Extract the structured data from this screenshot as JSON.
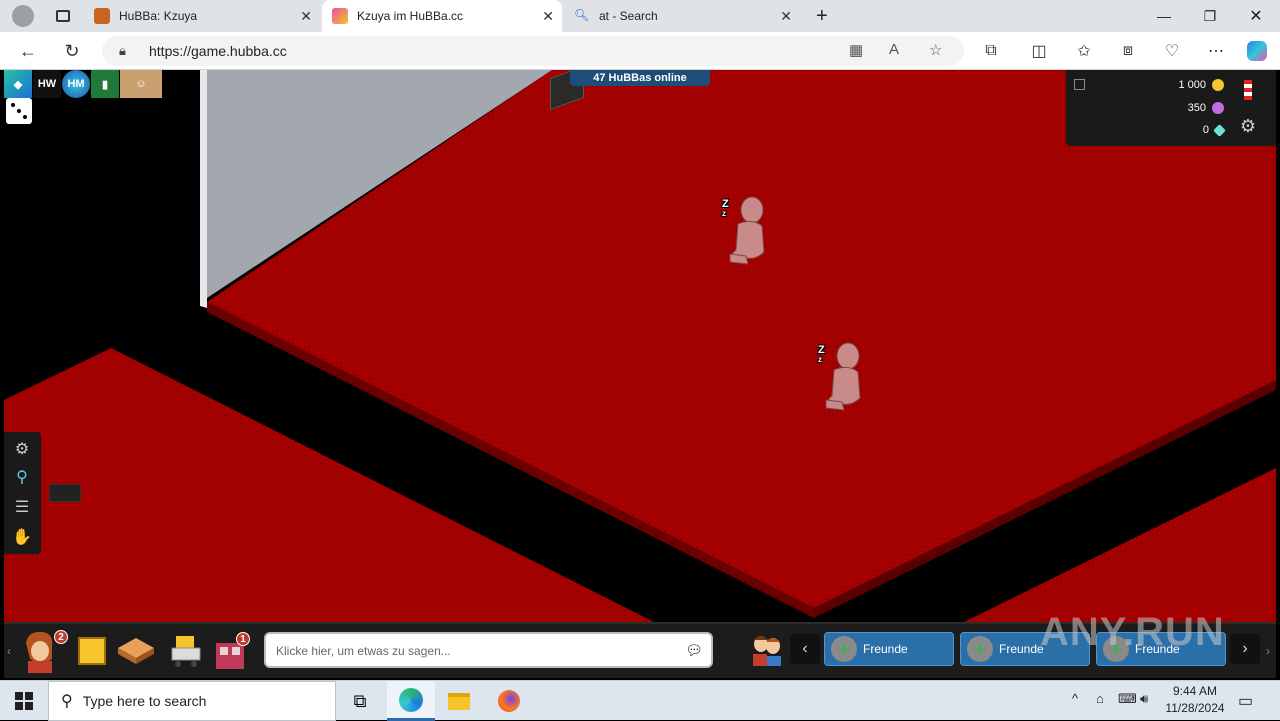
{
  "browser": {
    "tabs": [
      {
        "label": "HuBBa: Kzuya",
        "active": false
      },
      {
        "label": "Kzuya im HuBBa.cc",
        "active": true
      },
      {
        "label": "at - Search",
        "active": false
      }
    ],
    "url": "https://game.hubba.cc"
  },
  "game": {
    "online_label": "47 HuBBas online",
    "top_logos": [
      "HW",
      "HM"
    ],
    "purse": {
      "credits": "1 000",
      "duckets": "350",
      "diamonds": "0"
    },
    "avatars": [
      {
        "status": "sleeping",
        "zz": "z"
      },
      {
        "status": "sleeping",
        "zz": "z"
      }
    ],
    "badges": {
      "avatar_badge": "2",
      "shop_badge": "1"
    },
    "chat_placeholder": "Klicke hier, um etwas zu sagen...",
    "friend_slots": [
      {
        "label": "Freunde"
      },
      {
        "label": "Freunde"
      },
      {
        "label": "Freunde"
      }
    ],
    "watermark": "ANY.RUN"
  },
  "colors": {
    "floor": "#a60000",
    "wall": "#a3a7b0",
    "accent": "#2a6fa8"
  },
  "taskbar": {
    "search_placeholder": "Type here to search",
    "time": "9:44 AM",
    "date": "11/28/2024"
  }
}
